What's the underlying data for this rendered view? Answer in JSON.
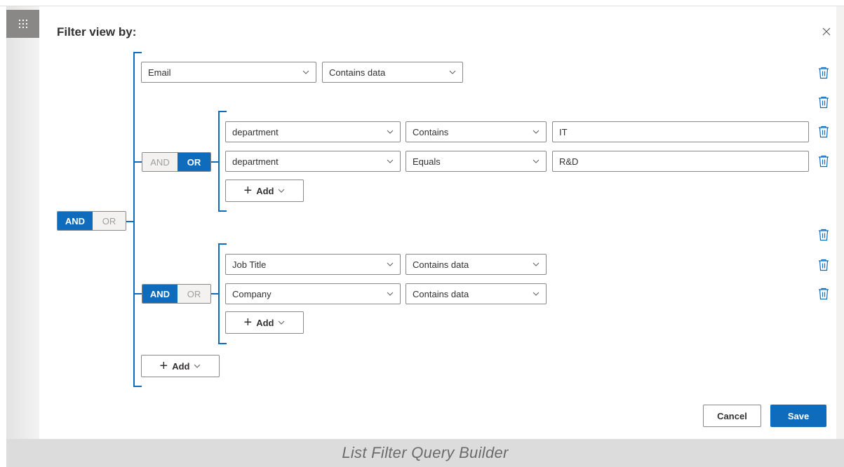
{
  "dialog": {
    "title": "Filter view by:",
    "close_icon": "close-icon"
  },
  "root_group": {
    "operator_and": "AND",
    "operator_or": "OR",
    "active": "AND"
  },
  "row1": {
    "field": "Email",
    "condition": "Contains data"
  },
  "group1": {
    "operator_and": "AND",
    "operator_or": "OR",
    "active": "OR",
    "rows": [
      {
        "field": "department",
        "condition": "Contains",
        "value": "IT"
      },
      {
        "field": "department",
        "condition": "Equals",
        "value": "R&D"
      }
    ],
    "add_label": "Add"
  },
  "group2": {
    "operator_and": "AND",
    "operator_or": "OR",
    "active": "AND",
    "rows": [
      {
        "field": "Job Title",
        "condition": "Contains data"
      },
      {
        "field": "Company",
        "condition": "Contains data"
      }
    ],
    "add_label": "Add"
  },
  "root_add_label": "Add",
  "footer": {
    "cancel_label": "Cancel",
    "save_label": "Save"
  },
  "caption": "List Filter Query Builder",
  "colors": {
    "accent": "#0f6cbd",
    "border": "#8a8886",
    "text": "#323130"
  }
}
